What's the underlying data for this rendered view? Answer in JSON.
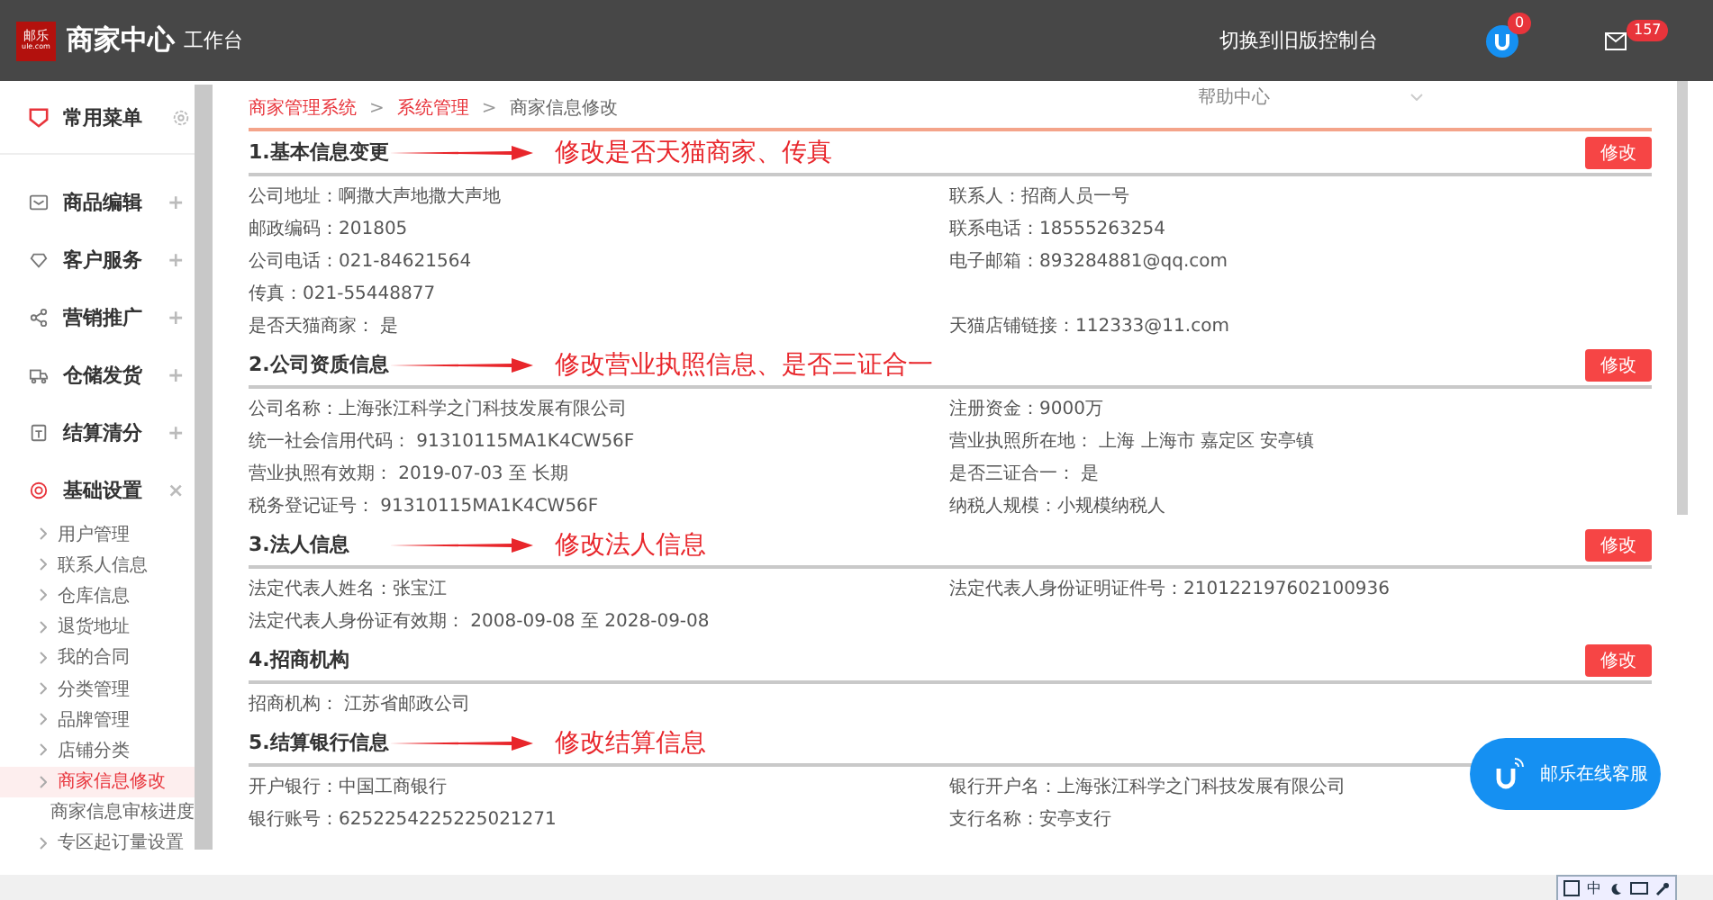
{
  "header": {
    "logo": {
      "top": "邮乐",
      "bottom": "ule.com"
    },
    "title": "商家中心",
    "subtitle": "工作台",
    "switch_link": "切换到旧版控制台",
    "user_badge": "0",
    "mail_badge": "157"
  },
  "help_menu": {
    "label": "帮助中心"
  },
  "sidebar": {
    "favorites": "常用菜单",
    "groups": [
      {
        "label": "商品编辑",
        "toggle": "+",
        "expanded": false
      },
      {
        "label": "客户服务",
        "toggle": "+",
        "expanded": false
      },
      {
        "label": "营销推广",
        "toggle": "+",
        "expanded": false
      },
      {
        "label": "仓储发货",
        "toggle": "+",
        "expanded": false
      },
      {
        "label": "结算清分",
        "toggle": "+",
        "expanded": false
      },
      {
        "label": "基础设置",
        "toggle": "×",
        "expanded": true,
        "children": [
          {
            "label": "用户管理",
            "selected": false
          },
          {
            "label": "联系人信息",
            "selected": false
          },
          {
            "label": "仓库信息",
            "selected": false
          },
          {
            "label": "退货地址",
            "selected": false
          },
          {
            "label": "我的合同",
            "selected": false
          },
          {
            "label": "分类管理",
            "selected": false
          },
          {
            "label": "品牌管理",
            "selected": false
          },
          {
            "label": "店铺分类",
            "selected": false
          },
          {
            "label": "商家信息修改",
            "selected": true
          },
          {
            "label": "商家信息审核进度",
            "selected": false
          },
          {
            "label": "专区起订量设置",
            "selected": false
          }
        ]
      }
    ]
  },
  "breadcrumb": {
    "separator": ">",
    "items": [
      {
        "label": "商家管理系统",
        "link": true
      },
      {
        "label": "系统管理",
        "link": true
      },
      {
        "label": "商家信息修改",
        "link": false
      }
    ]
  },
  "sections": [
    {
      "title": "1.基本信息变更",
      "button": "修改",
      "annotation": "修改是否天猫商家、传真",
      "rows": [
        {
          "left": "公司地址：啊撒大声地撒大声地",
          "right": "联系人：招商人员一号"
        },
        {
          "left": "邮政编码：201805",
          "right": "联系电话：18555263254"
        },
        {
          "left": "公司电话：021-84621564",
          "right": "电子邮箱：893284881@qq.com"
        },
        {
          "left": "传真：021-55448877"
        },
        {
          "left": "是否天猫商家： 是",
          "right": "天猫店铺链接：112333@11.com"
        }
      ]
    },
    {
      "title": "2.公司资质信息",
      "button": "修改",
      "annotation": "修改营业执照信息、是否三证合一",
      "rows": [
        {
          "left": "公司名称：上海张江科学之门科技发展有限公司",
          "right": "注册资金：9000万"
        },
        {
          "left": "统一社会信用代码： 91310115MA1K4CW56F",
          "right": "营业执照所在地： 上海 上海市 嘉定区 安亭镇"
        },
        {
          "left": "营业执照有效期： 2019-07-03 至 长期",
          "right": "是否三证合一： 是"
        },
        {
          "left": "税务登记证号： 91310115MA1K4CW56F",
          "right": "纳税人规模：小规模纳税人"
        }
      ]
    },
    {
      "title": "3.法人信息",
      "button": "修改",
      "annotation": "修改法人信息",
      "rows": [
        {
          "left": "法定代表人姓名：张宝江",
          "right": "法定代表人身份证明证件号：210122197602100936"
        },
        {
          "left": "法定代表人身份证有效期： 2008-09-08 至 2028-09-08"
        }
      ]
    },
    {
      "title": "4.招商机构",
      "button": "修改",
      "rows": [
        {
          "left": "招商机构： 江苏省邮政公司"
        }
      ]
    },
    {
      "title": "5.结算银行信息",
      "annotation": "修改结算信息",
      "rows": [
        {
          "left": "开户银行：中国工商银行",
          "right": "银行开户名：上海张江科学之门科技发展有限公司"
        },
        {
          "left": "银行账号：6252254225225021271",
          "right": "支行名称：安亭支行"
        }
      ]
    }
  ],
  "chat_button": {
    "label": "邮乐在线客服"
  },
  "ime_bar": {
    "language": "中"
  }
}
